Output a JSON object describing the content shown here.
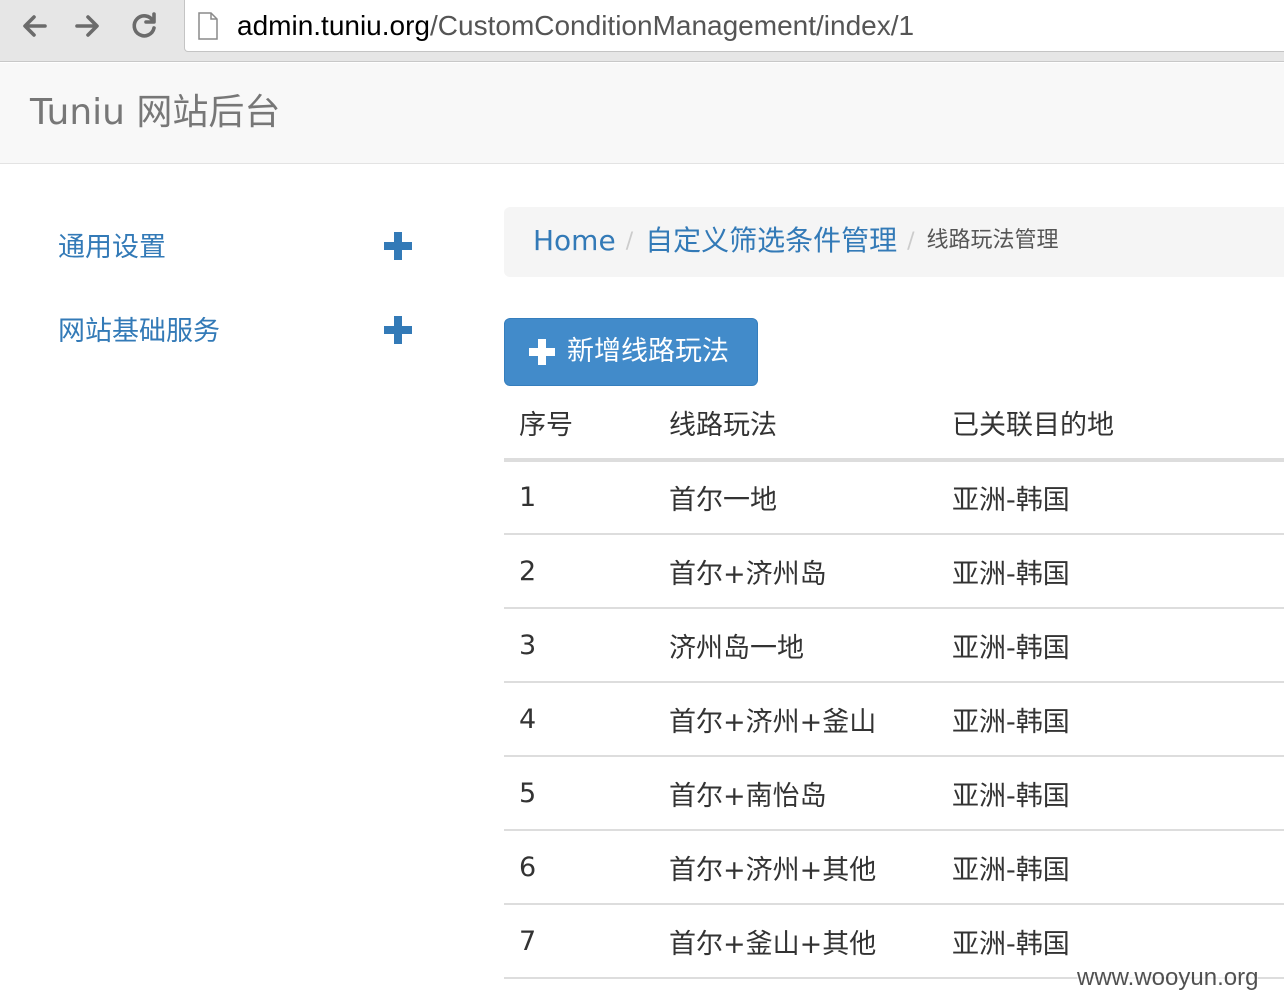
{
  "browser": {
    "url_domain": "admin.tuniu.org",
    "url_path": "/CustomConditionManagement/index/1"
  },
  "navbar": {
    "brand": "Tuniu 网站后台"
  },
  "sidebar": {
    "items": [
      {
        "label": "通用设置",
        "icon": "plus-icon"
      },
      {
        "label": "网站基础服务",
        "icon": "plus-icon"
      }
    ]
  },
  "breadcrumb": {
    "items": [
      "Home",
      "自定义筛选条件管理"
    ],
    "active": "线路玩法管理",
    "separator": "/"
  },
  "toolbar": {
    "add_label": "新增线路玩法",
    "add_icon": "plus-icon"
  },
  "table": {
    "headers": [
      "序号",
      "线路玩法",
      "已关联目的地"
    ],
    "rows": [
      [
        "1",
        "首尔一地",
        "亚洲-韩国"
      ],
      [
        "2",
        "首尔+济州岛",
        "亚洲-韩国"
      ],
      [
        "3",
        "济州岛一地",
        "亚洲-韩国"
      ],
      [
        "4",
        "首尔+济州+釜山",
        "亚洲-韩国"
      ],
      [
        "5",
        "首尔+南怡岛",
        "亚洲-韩国"
      ],
      [
        "6",
        "首尔+济州+其他",
        "亚洲-韩国"
      ],
      [
        "7",
        "首尔+釜山+其他",
        "亚洲-韩国"
      ]
    ]
  },
  "watermark": "www.wooyun.org",
  "colors": {
    "link": "#337ab7",
    "primary_button": "#428bca",
    "navbar_bg": "#f8f8f8",
    "breadcrumb_bg": "#f5f5f5",
    "table_border": "#dddddd"
  }
}
